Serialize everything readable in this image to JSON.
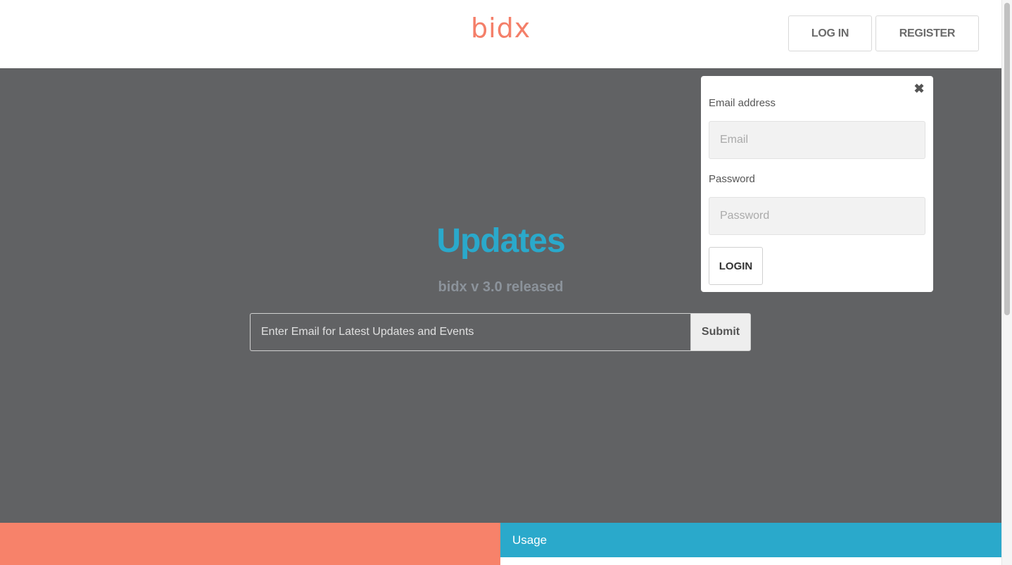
{
  "header": {
    "logo": "bidx",
    "login_label": "LOG IN",
    "register_label": "REGISTER"
  },
  "hero": {
    "title": "Updates",
    "subtitle": "bidx v 3.0 released",
    "subscribe_placeholder": "Enter Email for Latest Updates and Events",
    "submit_label": "Submit"
  },
  "login_popup": {
    "close_icon": "✖",
    "email_label": "Email address",
    "email_placeholder": "Email",
    "password_label": "Password",
    "password_placeholder": "Password",
    "login_button": "LOGIN"
  },
  "footer_band": {
    "usage_label": "Usage"
  },
  "colors": {
    "brand": "#f47f69",
    "accent_blue": "#2aa9cb",
    "hero_bg": "#616264"
  }
}
